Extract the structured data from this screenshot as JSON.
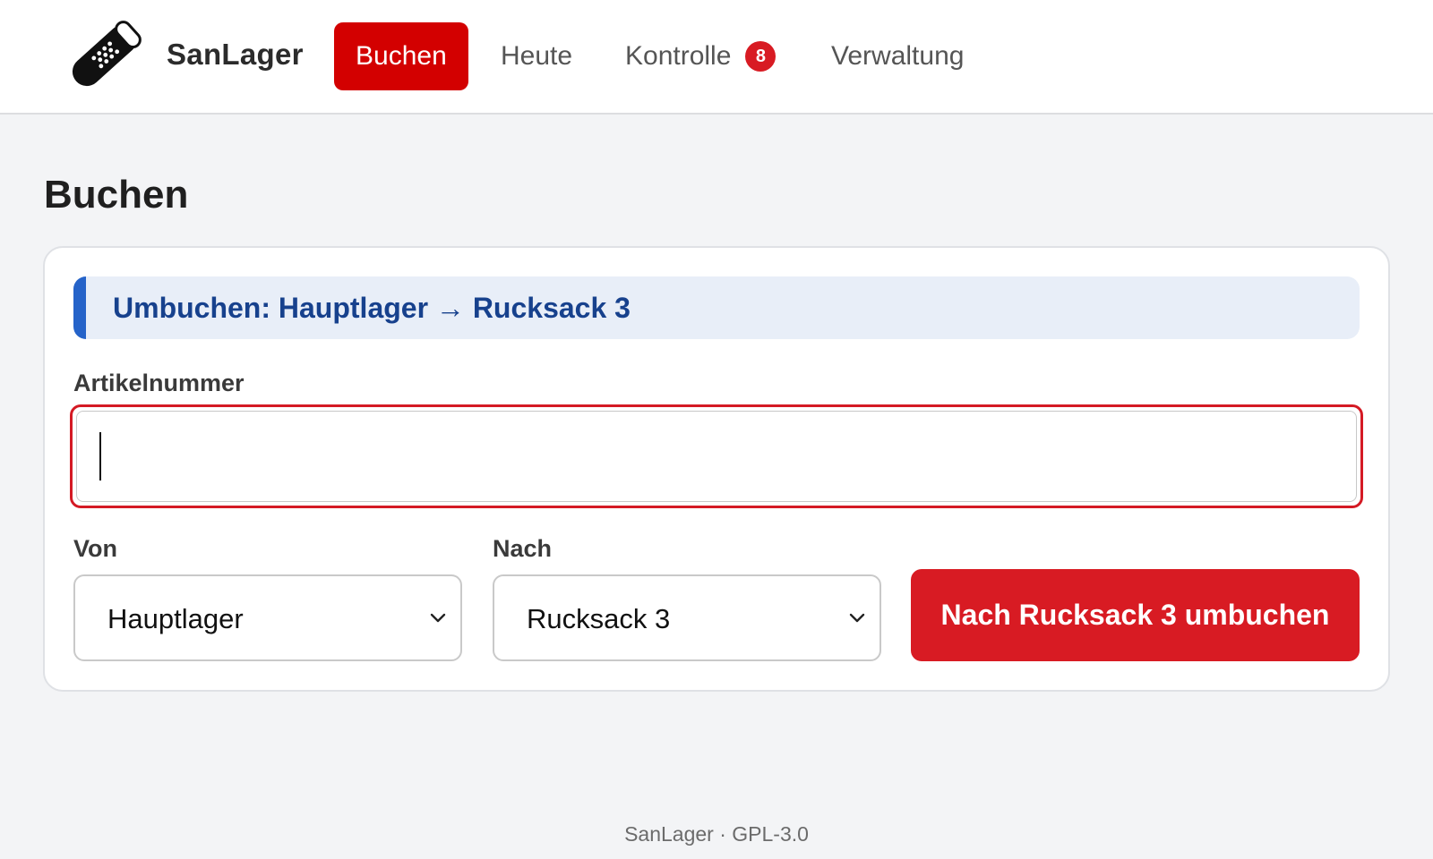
{
  "app": {
    "name": "SanLager",
    "logo_icon": "bandage-icon"
  },
  "nav": {
    "items": [
      {
        "label": "Buchen",
        "active": true
      },
      {
        "label": "Heute",
        "active": false
      },
      {
        "label": "Kontrolle",
        "active": false,
        "badge": "8"
      },
      {
        "label": "Verwaltung",
        "active": false
      }
    ]
  },
  "page": {
    "title": "Buchen"
  },
  "banner": {
    "text": "Umbuchen: Hauptlager → Rucksack 3"
  },
  "form": {
    "article_label": "Artikelnummer",
    "article_value": "",
    "from_label": "Von",
    "from_value": "Hauptlager",
    "to_label": "Nach",
    "to_value": "Rucksack 3",
    "submit_label": "Nach Rucksack 3 umbuchen"
  },
  "footer": {
    "text": "SanLager · GPL-3.0"
  },
  "colors": {
    "accent": "#d30000",
    "button": "#d81b23",
    "banner_bg": "#e8eef8",
    "banner_bar": "#2563c9",
    "banner_text": "#17418d"
  }
}
